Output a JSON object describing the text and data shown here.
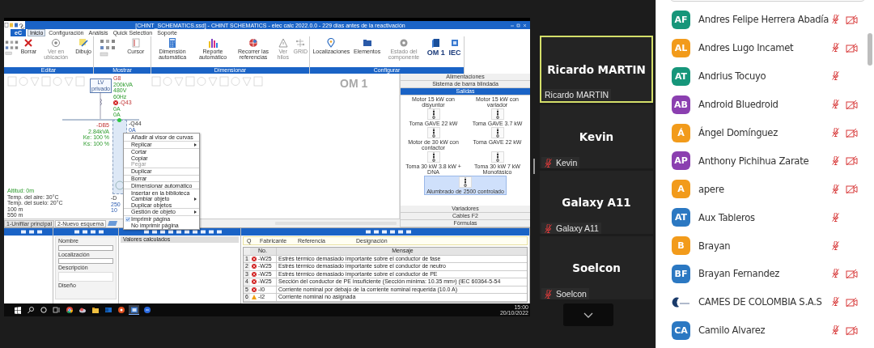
{
  "shared_screen": {
    "window_title": "[CHINT_SCHEMATICS.ssd] - CHINT SCHEMATICS - elec calc 2022.0.0 - 229 días antes de la reactivación",
    "app_button": "eC",
    "menu_tabs": [
      {
        "label": "Inicio",
        "selected": true
      },
      {
        "label": "Configuración",
        "selected": false
      },
      {
        "label": "Análisis",
        "selected": false
      },
      {
        "label": "Quick Selection",
        "selected": false
      },
      {
        "label": "Soporte",
        "selected": false
      }
    ],
    "ribbon_groups": [
      {
        "label": "Editar",
        "tool_icons": true,
        "buttons": [
          {
            "label": "Borrar",
            "kind": "delete",
            "large": false,
            "disabled": false
          },
          {
            "label": "Ver en ubicación",
            "kind": "eye",
            "large": false,
            "disabled": true
          },
          {
            "label": "Dibujo",
            "kind": "draw",
            "large": false,
            "disabled": false
          }
        ]
      },
      {
        "label": "Mostrar",
        "tool_icons": true,
        "buttons": [
          {
            "label": "Cursor",
            "kind": "cursor",
            "large": false,
            "disabled": false
          }
        ]
      },
      {
        "label": "Dimensionar",
        "tool_icons": false,
        "buttons": [
          {
            "label": "Dimensión automática",
            "kind": "calc",
            "large": false,
            "disabled": false
          },
          {
            "label": "Reporte automático",
            "kind": "chart",
            "large": false,
            "disabled": false
          },
          {
            "label": "Recorrer las referencias",
            "kind": "refs",
            "large": false,
            "disabled": false
          },
          {
            "label": "Ver hilos",
            "kind": "warning",
            "large": false,
            "disabled": true
          },
          {
            "label": "GRID",
            "kind": "grid",
            "large": false,
            "disabled": true
          }
        ]
      },
      {
        "label": "Configurar",
        "tool_icons": false,
        "buttons": [
          {
            "label": "Localizaciones",
            "kind": "location",
            "large": false,
            "disabled": false
          },
          {
            "label": "Elementos",
            "kind": "elements",
            "large": false,
            "disabled": false
          },
          {
            "label": "Estado del componente",
            "kind": "status",
            "large": false,
            "disabled": true
          },
          {
            "label": "OM 1",
            "kind": "page",
            "large": true,
            "disabled": false
          },
          {
            "label": "IEC",
            "kind": "standard",
            "large": true,
            "disabled": false
          }
        ]
      }
    ],
    "canvas": {
      "page_label": "OM 1",
      "source_block": "LV privado",
      "source_labels": [
        {
          "text": "G8",
          "kind": "name"
        },
        {
          "text": "200kVA",
          "kind": "value"
        },
        {
          "text": "480V",
          "kind": "value"
        },
        {
          "text": "60Hz",
          "kind": "value"
        },
        {
          "text": "-Q43",
          "kind": "error"
        },
        {
          "text": "0A",
          "kind": "value"
        },
        {
          "text": "0A",
          "kind": "value"
        }
      ],
      "board_labels": [
        {
          "text": "-DB5",
          "kind": "name"
        },
        {
          "text": "2.84kVA",
          "kind": "value"
        },
        {
          "text": "Ke: 100 %",
          "kind": "value"
        },
        {
          "text": "Ks: 100 %",
          "kind": "value"
        }
      ],
      "feeder_labels": [
        {
          "text": "-Q44",
          "kind": "plain"
        },
        {
          "text": "0A",
          "kind": "detail"
        }
      ],
      "load_labels": [
        {
          "text": "-D",
          "kind": "plain"
        },
        {
          "text": "250",
          "kind": "detail"
        },
        {
          "text": "10",
          "kind": "detail"
        }
      ],
      "site_labels": [
        {
          "text": "Altitud: 0m",
          "kind": "value"
        },
        {
          "text": "Temp. del aire: 30°C",
          "kind": "plain"
        },
        {
          "text": "Temp. del suelo: 20°C",
          "kind": "plain"
        },
        {
          "text": "100 m",
          "kind": "plain"
        },
        {
          "text": "550 m",
          "kind": "plain"
        }
      ]
    },
    "context_menu": [
      {
        "label": "Añadir al visor de curvas",
        "submenu": false,
        "checked": false,
        "disabled": false,
        "separator_before": false
      },
      {
        "label": "Replicar",
        "submenu": true,
        "checked": false,
        "disabled": false,
        "separator_before": true
      },
      {
        "label": "Cortar",
        "submenu": false,
        "checked": false,
        "disabled": false,
        "separator_before": true
      },
      {
        "label": "Copiar",
        "submenu": false,
        "checked": false,
        "disabled": false,
        "separator_before": false
      },
      {
        "label": "Pegar",
        "submenu": false,
        "checked": false,
        "disabled": true,
        "separator_before": false
      },
      {
        "label": "Duplicar",
        "submenu": false,
        "checked": false,
        "disabled": false,
        "separator_before": true
      },
      {
        "label": "Borrar",
        "submenu": false,
        "checked": false,
        "disabled": false,
        "separator_before": true
      },
      {
        "label": "Dimensionar automático",
        "submenu": false,
        "checked": false,
        "disabled": false,
        "separator_before": true
      },
      {
        "label": "Insertar en la biblioteca",
        "submenu": false,
        "checked": false,
        "disabled": false,
        "separator_before": true
      },
      {
        "label": "Cambiar objeto",
        "submenu": true,
        "checked": false,
        "disabled": false,
        "separator_before": false
      },
      {
        "label": "Duplicar objetos",
        "submenu": false,
        "checked": false,
        "disabled": false,
        "separator_before": false
      },
      {
        "label": "Gestión de objeto",
        "submenu": true,
        "checked": false,
        "disabled": false,
        "separator_before": true
      },
      {
        "label": "Imprimir página",
        "submenu": false,
        "checked": true,
        "disabled": false,
        "separator_before": true
      },
      {
        "label": "No imprimir página",
        "submenu": false,
        "checked": false,
        "disabled": false,
        "separator_before": false
      }
    ],
    "library": {
      "sections_top": [
        {
          "label": "Alimentaciones",
          "selected": false
        },
        {
          "label": "Sistema de barra blindada",
          "selected": false
        },
        {
          "label": "Salidas",
          "selected": true
        }
      ],
      "items": [
        {
          "label": "Motor 15 kW con disyuntor",
          "kind": "caption",
          "selected": false
        },
        {
          "label": "Motor 15 kW con variador",
          "kind": "caption",
          "selected": false
        },
        {
          "label": "Toma GAVE 22 kW",
          "kind": "symbol",
          "selected": false
        },
        {
          "label": "Toma GAVE 3.7 kW",
          "kind": "symbol",
          "selected": false
        },
        {
          "label": "Motor de 30 kW con contactor",
          "kind": "symbol",
          "selected": false
        },
        {
          "label": "Toma GAVE 22 kW",
          "kind": "symbol",
          "selected": false
        },
        {
          "label": "Toma 30 kW 3.8 kW + DNA",
          "kind": "symbol",
          "selected": false
        },
        {
          "label": "Toma 30 kW 7 kW Monofásico",
          "kind": "symbol",
          "selected": false
        },
        {
          "label": "Alumbrado de 2500 controlado",
          "kind": "symbol",
          "selected": true
        }
      ],
      "sections_bottom": [
        {
          "label": "Variadores",
          "selected": false
        },
        {
          "label": "Cables F2",
          "selected": false
        },
        {
          "label": "Fórmulas",
          "selected": false
        }
      ]
    },
    "page_tabs": [
      {
        "label": "1-Unifilar principal",
        "selected": false
      },
      {
        "label": "2-Nuevo esquema",
        "selected": true
      }
    ],
    "properties": [
      "Nombre",
      "Localización",
      "Descripción",
      "Diseño"
    ],
    "calculated_values_title": "Valores calculados",
    "component_columns": [
      "Q",
      "Fabricante",
      "Referencia",
      "Designación"
    ],
    "messages": {
      "columns": [
        "No.",
        "Mensaje"
      ],
      "rows": [
        {
          "index": "1",
          "kind": "error",
          "ref": "-W25",
          "text": "Estrés térmico demasiado importante sobre el conductor de fase"
        },
        {
          "index": "2",
          "kind": "error",
          "ref": "-W25",
          "text": "Estrés térmico demasiado importante sobre el conductor de neutro"
        },
        {
          "index": "3",
          "kind": "error",
          "ref": "-W25",
          "text": "Estrés térmico demasiado importante sobre el conductor de PE"
        },
        {
          "index": "4",
          "kind": "error",
          "ref": "-W25",
          "text": "Sección del conductor de PE insuficiente (Sección mínima: 10.35 mm²) (IEC 60364-5-54"
        },
        {
          "index": "5",
          "kind": "error",
          "ref": "-I0",
          "text": "Corriente nominal por debajo de la corriente nominal requerida (10.0 A)"
        },
        {
          "index": "6",
          "kind": "warning",
          "ref": "-I2",
          "text": "Corriente nominal no asignada"
        }
      ]
    },
    "taskbar": {
      "apps": [
        {
          "kind": "start",
          "active": false
        },
        {
          "kind": "search",
          "active": false
        },
        {
          "kind": "cortana",
          "active": false
        },
        {
          "kind": "taskview",
          "active": false
        },
        {
          "kind": "browser",
          "active": false
        },
        {
          "kind": "cloud",
          "active": false
        },
        {
          "kind": "folder",
          "active": false
        },
        {
          "kind": "mail",
          "active": false
        },
        {
          "kind": "pdf",
          "active": false
        },
        {
          "kind": "app",
          "active": true
        },
        {
          "kind": "chat",
          "active": false
        }
      ],
      "time": "15:00",
      "date": "20/10/2022"
    }
  },
  "tiles": [
    {
      "name": "Ricardo MARTIN",
      "label": "Ricardo MARTIN",
      "speaking": true,
      "muted": false
    },
    {
      "name": "Kevin",
      "label": "Kevin",
      "speaking": false,
      "muted": true
    },
    {
      "name": "Galaxy A11",
      "label": "Galaxy A11",
      "speaking": false,
      "muted": true
    },
    {
      "name": "Soelcon",
      "label": "Soelcon",
      "speaking": false,
      "muted": true
    }
  ],
  "participants": [
    {
      "initials": "AF",
      "name": "Andres Felipe Herrera Abadía",
      "kind": "initials",
      "color": "#16967a",
      "muted": true,
      "video_off": true
    },
    {
      "initials": "AL",
      "name": "Andres Lugo Incamet",
      "kind": "initials",
      "color": "#f29b1b",
      "muted": true,
      "video_off": true
    },
    {
      "initials": "AT",
      "name": "Andrius Tocuyo",
      "kind": "initials",
      "color": "#16967a",
      "muted": true,
      "video_off": false
    },
    {
      "initials": "AB",
      "name": "Android Bluedroid",
      "kind": "initials",
      "color": "#8b3fb0",
      "muted": true,
      "video_off": true
    },
    {
      "initials": "Á",
      "name": "Ángel Domínguez",
      "kind": "initials",
      "color": "#f29b1b",
      "muted": true,
      "video_off": true
    },
    {
      "initials": "AP",
      "name": "Anthony Pichihua Zarate",
      "kind": "initials",
      "color": "#8b3fb0",
      "muted": true,
      "video_off": true
    },
    {
      "initials": "A",
      "name": "apere",
      "kind": "initials",
      "color": "#f29b1b",
      "muted": true,
      "video_off": true
    },
    {
      "initials": "AT",
      "name": "Aux Tableros",
      "kind": "initials",
      "color": "#2b78c2",
      "muted": true,
      "video_off": false
    },
    {
      "initials": "B",
      "name": "Brayan",
      "kind": "initials",
      "color": "#f29b1b",
      "muted": true,
      "video_off": false
    },
    {
      "initials": "BF",
      "name": "Brayan Fernandez",
      "kind": "initials",
      "color": "#2b78c2",
      "muted": true,
      "video_off": true
    },
    {
      "name": "CAMES DE COLOMBIA S.A.S",
      "kind": "logo",
      "muted": true,
      "video_off": true
    },
    {
      "initials": "CA",
      "name": "Camilo Alvarez",
      "kind": "initials",
      "color": "#2b78c2",
      "muted": true,
      "video_off": true
    }
  ]
}
